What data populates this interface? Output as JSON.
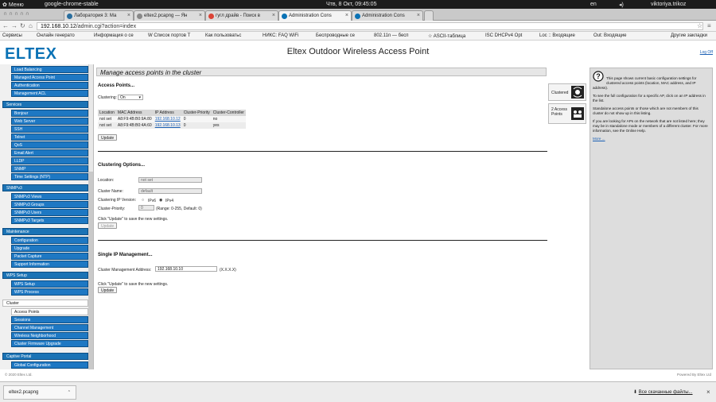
{
  "panel": {
    "menu": "Меню",
    "app_title": "google-chrome-stable",
    "clock": "Чтв,  8 Окт, 09:45:05",
    "lang": "en",
    "user": "viktoriya.trikoz"
  },
  "tabs": [
    {
      "label": "Лаборатория 3: Ма",
      "active": false
    },
    {
      "label": "eltex2.pcapng — Ян",
      "active": false
    },
    {
      "label": "гугл драйв - Поиск в",
      "active": false
    },
    {
      "label": "Administration Cons",
      "active": true
    },
    {
      "label": "Administration Cons",
      "active": false
    }
  ],
  "address": {
    "host": "192.168.10.12",
    "path": "/admin.cgi?action=index"
  },
  "bookmarks": [
    "Сервисы",
    "Онлайн генерато",
    "Информация о се",
    "W  Список портов T",
    "Как пользоватьс",
    "НИКС: FAQ WiFi",
    "Беспроводные се",
    "802.11n — бесп",
    "☆ ASCII-таблица",
    "ISC DHCPv4 Opt",
    "Loc :: Входящие",
    "Out: Входящие",
    "Другие закладки"
  ],
  "header": {
    "logo": "ELTEX",
    "product": "Eltex Outdoor Wireless Access Point",
    "logout": "Log Off"
  },
  "sidebar": {
    "top_items": [
      "Load Balancing",
      "Managed Access Point",
      "Authentication",
      "Management ACL"
    ],
    "groups": [
      {
        "label": "Services",
        "items": [
          "Bonjour",
          "Web Server",
          "SSH",
          "Telnet",
          "QoS",
          "Email Alert",
          "LLDP",
          "SNMP",
          "Time Settings (NTP)"
        ]
      },
      {
        "label": "SNMPv3",
        "items": [
          "SNMPv3 Views",
          "SNMPv3 Groups",
          "SNMPv3 Users",
          "SNMPv3 Targets"
        ]
      },
      {
        "label": "Maintenance",
        "items": [
          "Configuration",
          "Upgrade",
          "Packet Capture",
          "Support Information"
        ]
      },
      {
        "label": "WPS Setup",
        "items": [
          "WPS Setup",
          "WPS Process"
        ]
      },
      {
        "label": "Cluster",
        "items": [
          "Access Points",
          "Sessions",
          "Channel Management",
          "Wireless Neighborhood",
          "Cluster Firmware Upgrade"
        ]
      },
      {
        "label": "Captive Portal",
        "items": [
          "Global Configuration"
        ]
      }
    ]
  },
  "page": {
    "title": "Manage access points in the cluster",
    "access_points": {
      "heading": "Access Points...",
      "clustering_label": "Clustering:",
      "clustering_value": "On",
      "columns": [
        "Location",
        "MAC Address",
        "IP Address",
        "Cluster-Priority",
        "Cluster-Controller"
      ],
      "rows": [
        [
          "not set",
          "A8:F9:4B:B0:9A:80",
          "192.168.10.12",
          "0",
          "no"
        ],
        [
          "not set",
          "A8:F9:4B:B0:4A:60",
          "192.168.10.13",
          "0",
          "yes"
        ]
      ],
      "update": "Update"
    },
    "clustering_options": {
      "heading": "Clustering Options...",
      "location_label": "Location:",
      "location_value": "not set",
      "cluster_name_label": "Cluster Name:",
      "cluster_name_value": "default",
      "ip_version_label": "Clustering IP Version:",
      "ipv6": "IPv6",
      "ipv4": "IPv4",
      "priority_label": "Cluster-Priority:",
      "priority_value": "0",
      "priority_hint": "(Range: 0-255, Default: 0)",
      "hint": "Click \"Update\" to save the new settings.",
      "update": "Update"
    },
    "single_ip": {
      "heading": "Single IP Management...",
      "address_label": "Cluster Management Address:",
      "address_value": "192.168.10.10",
      "address_hint": "(X.X.X.X)",
      "hint": "Click \"Update\" to save the new settings.",
      "update": "Update"
    }
  },
  "side_boxes": [
    {
      "label": "Clustered"
    },
    {
      "label": "2 Access Points"
    }
  ],
  "help": {
    "p1": "This page shows current basic configuration settings for clustered access points (location, MAC address, and IP address).",
    "p2": "To see the full configuration for a specific AP, click on an IP address in the list.",
    "p3": "Standalone access points or those which are not members of this cluster do not show up in this listing.",
    "p4": "If you are looking for APs on the network that are not listed here; they may be in standalone mode or members of a different cluster. For more information, see the Online Help.",
    "more": "More ..."
  },
  "footer": {
    "left": "© 2020 Eltex Ltd.",
    "right": "Powered By Eltex Ltd"
  },
  "download": {
    "file": "eltex2.pcapng",
    "all": "Все скачанные файлы..."
  },
  "colors": {
    "accent": "#1b73b5",
    "logo": "#0a72b5"
  }
}
